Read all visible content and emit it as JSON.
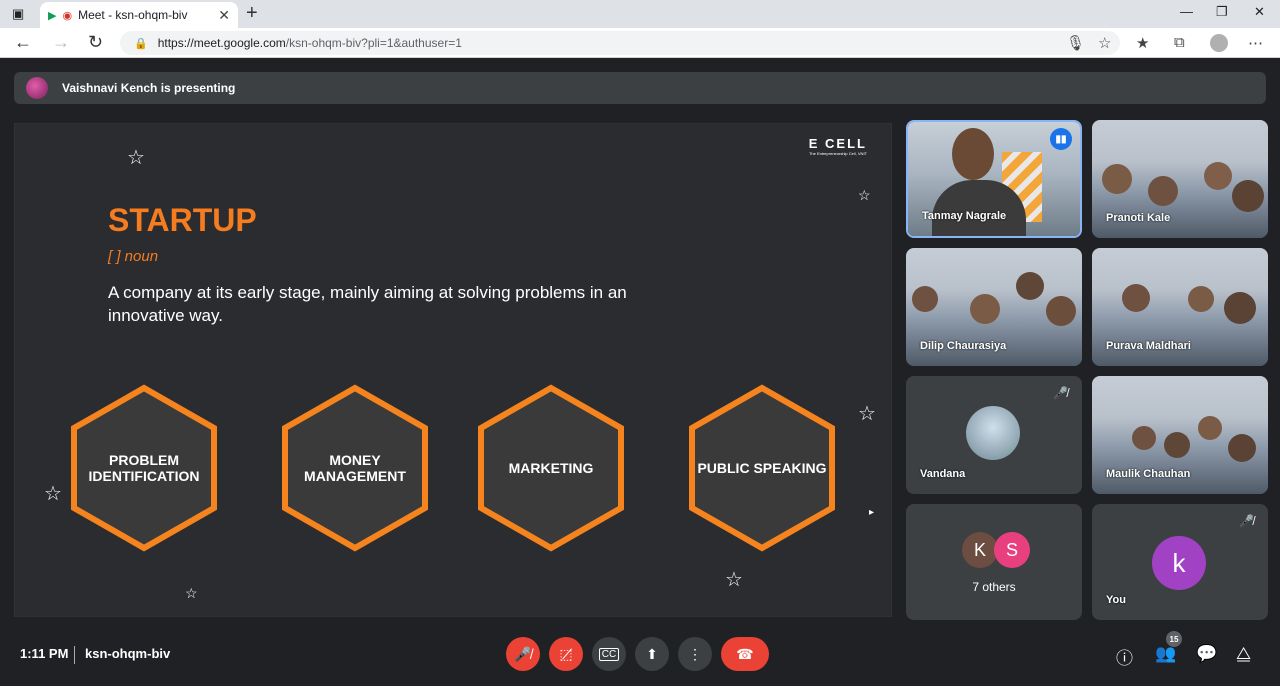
{
  "browser": {
    "tab_title": "Meet - ksn-ohqm-biv",
    "url_host": "https://meet.google.com",
    "url_path": "/ksn-ohqm-biv?pli=1&authuser=1"
  },
  "banner": {
    "text": "Vaishnavi Kench is presenting"
  },
  "slide": {
    "logo": "E CELL",
    "logo_sub": "The Entrepreneurship Cell, VNIT",
    "title": "STARTUP",
    "noun": "[ ] noun",
    "definition": "A company at its early stage, mainly aiming at solving problems in an innovative way.",
    "hexagons": [
      {
        "label": "PROBLEM IDENTIFICATION"
      },
      {
        "label": "MONEY MANAGEMENT"
      },
      {
        "label": "MARKETING"
      },
      {
        "label": "PUBLIC SPEAKING"
      }
    ],
    "accent": "#f57c1f"
  },
  "participants": [
    {
      "name": "Tanmay Nagrale",
      "speaking": true
    },
    {
      "name": "Pranoti Kale"
    },
    {
      "name": "Dilip Chaurasiya"
    },
    {
      "name": "Purava Maldhari"
    },
    {
      "name": "Vandana",
      "muted": true
    },
    {
      "name": "Maulik Chauhan"
    },
    {
      "name": "7 others",
      "initials": [
        "K",
        "S"
      ]
    },
    {
      "name": "You",
      "initial": "k",
      "muted": true
    }
  ],
  "bottom": {
    "time": "1:11 PM",
    "meeting_code": "ksn-ohqm-biv",
    "people_count": "15"
  }
}
